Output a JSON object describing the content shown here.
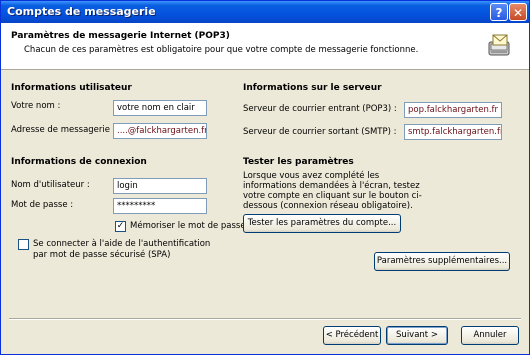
{
  "window": {
    "title": "Comptes de messagerie",
    "help_glyph": "?",
    "close_glyph": "✕"
  },
  "header": {
    "title": "Paramètres de messagerie Internet (POP3)",
    "subtitle": "Chacun de ces paramètres est obligatoire pour que votre compte de messagerie fonctionne."
  },
  "user_info": {
    "heading": "Informations utilisateur",
    "name_label": "Votre nom :",
    "name_value": "votre nom en clair",
    "email_label": "Adresse de messagerie :",
    "email_value": "....@falckhargarten.fr"
  },
  "server_info": {
    "heading": "Informations sur le serveur",
    "incoming_label": "Serveur de courrier entrant (POP3) :",
    "incoming_value": "pop.falckhargarten.fr",
    "outgoing_label": "Serveur de courrier sortant (SMTP) :",
    "outgoing_value": "smtp.falckhargarten.fr"
  },
  "logon_info": {
    "heading": "Informations de connexion",
    "user_label": "Nom d'utilisateur :",
    "user_value": "login",
    "password_label": "Mot de passe :",
    "password_value": "*********",
    "remember_label": "Mémoriser le mot de passe",
    "remember_checked": true,
    "spa_label_line1": "Se connecter à l'aide de l'authentification",
    "spa_label_line2": "par mot de passe sécurisé (SPA)",
    "spa_checked": false
  },
  "test": {
    "heading": "Tester les paramètres",
    "description": "Lorsque vous avez complété les informations demandées à l'écran, testez votre compte en cliquant sur le bouton ci-dessous (connexion réseau obligatoire).",
    "test_button": "Tester les paramètres du compte...",
    "more_button": "Paramètres supplémentaires..."
  },
  "footer": {
    "back": "< Précédent",
    "next": "Suivant >",
    "cancel": "Annuler"
  }
}
